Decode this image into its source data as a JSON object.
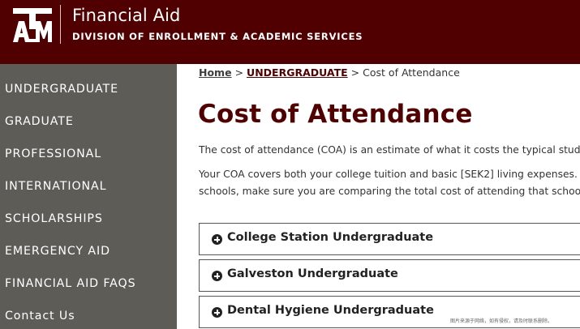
{
  "header": {
    "logo_text": "ATM",
    "title": "Financial Aid",
    "subtitle": "DIVISION OF ENROLLMENT & ACADEMIC SERVICES",
    "brand_color": "#500000"
  },
  "sidebar": {
    "background": "#5d5c57",
    "items": [
      {
        "label": "UNDERGRADUATE"
      },
      {
        "label": "GRADUATE"
      },
      {
        "label": "PROFESSIONAL"
      },
      {
        "label": "INTERNATIONAL"
      },
      {
        "label": "SCHOLARSHIPS"
      },
      {
        "label": "EMERGENCY AID"
      },
      {
        "label": "FINANCIAL AID FAQS"
      },
      {
        "label": "Contact Us"
      }
    ]
  },
  "breadcrumb": {
    "home": "Home",
    "separator": ">",
    "undergraduate": "UNDERGRADUATE",
    "current": "Cost of Attendance"
  },
  "main": {
    "title": "Cost of Attendance",
    "paragraph1": "The cost of attendance (COA) is an estimate of what it costs the typical student to a",
    "paragraph2_line1": "Your COA covers both your college tuition and basic [SEK2] living expenses. When",
    "paragraph2_line2": "schools, make sure you are comparing the total cost of attending that school, not j"
  },
  "accordions": [
    {
      "label": "College Station Undergraduate",
      "icon": "plus-circle-icon"
    },
    {
      "label": "Galveston Undergraduate",
      "icon": "plus-circle-icon"
    },
    {
      "label": "Dental Hygiene Undergraduate",
      "icon": "plus-circle-icon"
    }
  ],
  "watermark": "图片来源于网络，如有侵权，请及时联系删除。"
}
